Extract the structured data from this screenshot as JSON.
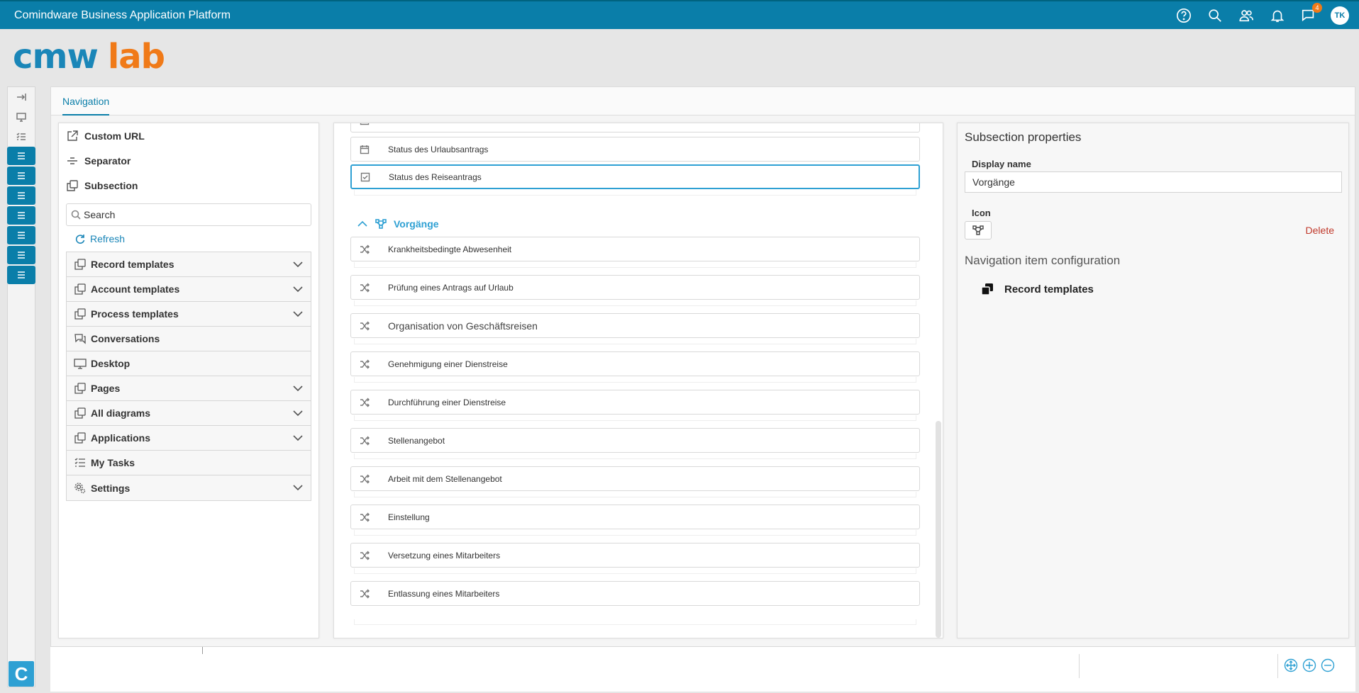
{
  "app": {
    "title": "Comindware Business Application Platform"
  },
  "topbar": {
    "notifications_count": "4",
    "avatar_initials": "TK",
    "icons": [
      "help-icon",
      "search-icon",
      "users-icon",
      "bell-icon",
      "chat-icon"
    ]
  },
  "logo": {
    "part1": "cmw",
    "part2": "lab"
  },
  "tabs": {
    "navigation": "Navigation"
  },
  "left": {
    "controls": {
      "custom_url": "Custom URL",
      "separator": "Separator",
      "subsection": "Subsection"
    },
    "search_placeholder": "Search",
    "refresh": "Refresh",
    "groups": [
      {
        "label": "Record templates",
        "expandable": true
      },
      {
        "label": "Account templates",
        "expandable": true
      },
      {
        "label": "Process templates",
        "expandable": true
      },
      {
        "label": "Conversations",
        "expandable": false
      },
      {
        "label": "Desktop",
        "expandable": false
      },
      {
        "label": "Pages",
        "expandable": true
      },
      {
        "label": "All diagrams",
        "expandable": true
      },
      {
        "label": "Applications",
        "expandable": true
      },
      {
        "label": "My Tasks",
        "expandable": false
      },
      {
        "label": "Settings",
        "expandable": true
      }
    ]
  },
  "middle": {
    "top_items": [
      {
        "label": "Status des Urlaubsantrags",
        "icon": "calendar-icon"
      },
      {
        "label": "Status des Reiseantrags",
        "icon": "checkbox-icon"
      }
    ],
    "section_title": "Vorgänge",
    "section_items": [
      "Krankheitsbedingte Abwesenheit",
      "Prüfung eines Antrags auf Urlaub",
      "Organisation von Geschäftsreisen",
      "Genehmigung einer Dienstreise",
      "Durchführung einer Dienstreise",
      "Stellenangebot",
      "Arbeit mit dem Stellenangebot",
      "Einstellung",
      "Versetzung eines Mitarbeiters",
      "Entlassung eines Mitarbeiters"
    ]
  },
  "right": {
    "title": "Subsection properties",
    "display_name_label": "Display name",
    "display_name_value": "Vorgänge",
    "icon_label": "Icon",
    "delete": "Delete",
    "nav_config_title": "Navigation item configuration",
    "nav_config_item": "Record templates"
  },
  "colors": {
    "topbar": "#0a7ea9",
    "accent": "#2ea0d3",
    "logo_orange": "#f07a18",
    "delete": "#c0392b"
  }
}
